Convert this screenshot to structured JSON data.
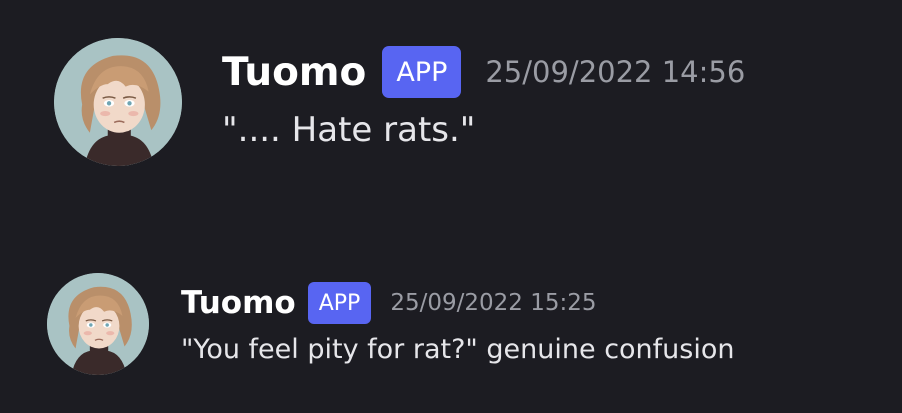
{
  "messages": [
    {
      "username": "Tuomo",
      "badge": "APP",
      "timestamp": "25/09/2022 14:56",
      "content": "\".... Hate rats.\""
    },
    {
      "username": "Tuomo",
      "badge": "APP",
      "timestamp": "25/09/2022 15:25",
      "content": "\"You feel pity for rat?\" genuine confusion"
    }
  ],
  "colors": {
    "background": "#1c1c22",
    "username": "#ffffff",
    "badge_background": "#5865f2",
    "timestamp": "#9a9ca4",
    "message_text": "#e6e6ea"
  },
  "icons": {
    "avatar": "user-avatar-icon"
  }
}
